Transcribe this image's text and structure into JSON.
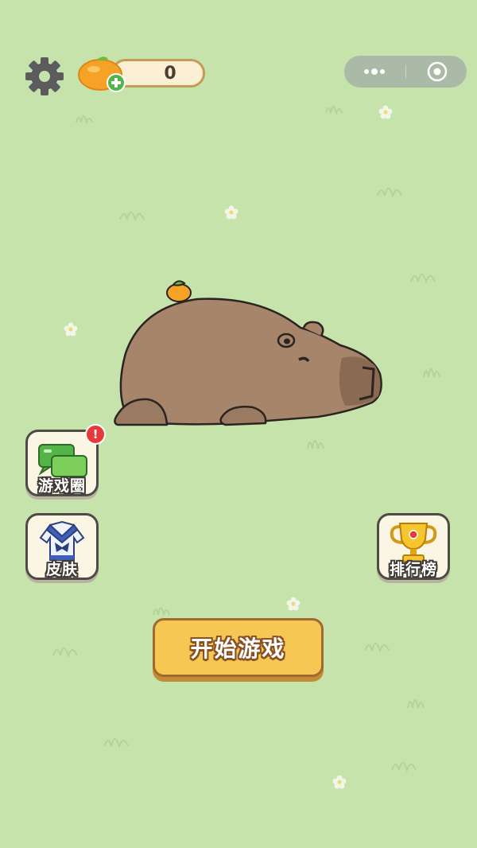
{
  "hud": {
    "currency_value": "0",
    "currency_icon": "orange-plus-icon",
    "settings_icon": "gear-icon"
  },
  "capsule": {
    "more_icon": "more-dots-icon",
    "close_icon": "target-close-icon"
  },
  "side_buttons": {
    "game_circle": {
      "label": "游戏圈",
      "badge": "!",
      "icon": "chat-bubbles-icon"
    },
    "skins": {
      "label": "皮肤",
      "icon": "uniform-icon"
    },
    "leaderboard": {
      "label": "排行榜",
      "icon": "trophy-icon"
    }
  },
  "start_button": {
    "label": "开始游戏"
  },
  "colors": {
    "background": "#c5e3ab",
    "button_yellow": "#f6c853",
    "capybara_brown": "#a6856a",
    "badge_red": "#e8393a"
  }
}
